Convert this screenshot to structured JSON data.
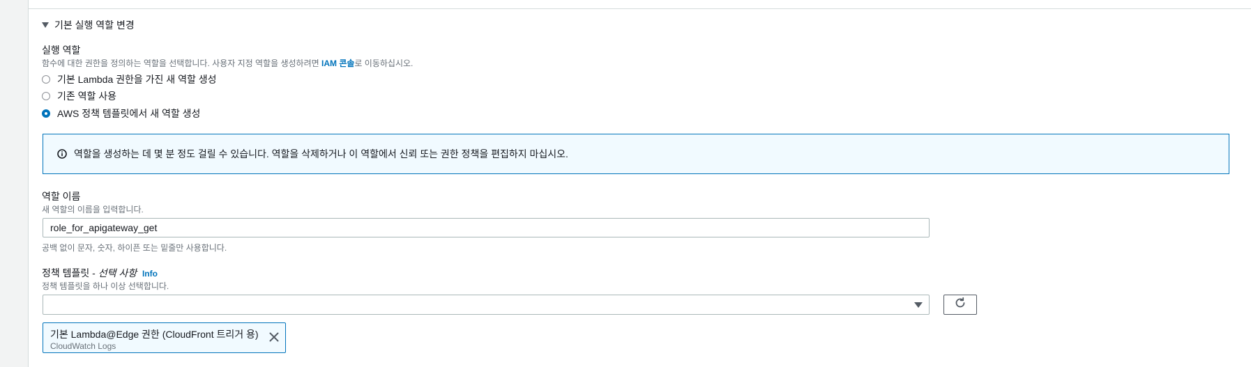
{
  "section": {
    "toggle_label": "기본 실행 역할 변경"
  },
  "execution_role": {
    "label": "실행 역할",
    "description_prefix": "함수에 대한 권한을 정의하는 역할을 선택합니다. 사용자 지정 역할을 생성하려면 ",
    "description_link": "IAM 콘솔",
    "description_suffix": "로 이동하십시오.",
    "options": [
      {
        "label": "기본 Lambda 권한을 가진 새 역할 생성",
        "checked": false
      },
      {
        "label": "기존 역할 사용",
        "checked": false
      },
      {
        "label": "AWS 정책 템플릿에서 새 역할 생성",
        "checked": true
      }
    ]
  },
  "info_alert": {
    "icon": "info-icon",
    "text": "역할을 생성하는 데 몇 분 정도 걸릴 수 있습니다. 역할을 삭제하거나 이 역할에서 신뢰 또는 권한 정책을 편집하지 마십시오."
  },
  "role_name": {
    "label": "역할 이름",
    "description": "새 역할의 이름을 입력합니다.",
    "value": "role_for_apigateway_get",
    "constraint": "공백 없이 문자, 숫자, 하이픈 또는 밑줄만 사용합니다."
  },
  "policy_templates": {
    "label": "정책 템플릿 - ",
    "optional": "선택 사항",
    "info_link": "Info",
    "description": "정책 템플릿을 하나 이상 선택합니다.",
    "select_value": "",
    "refresh_icon": "refresh-icon",
    "selected_tokens": [
      {
        "title": "기본 Lambda@Edge 권한 (CloudFront 트리거 용)",
        "subtitle": "CloudWatch Logs"
      }
    ]
  },
  "colors": {
    "link": "#0073bb",
    "info_bg": "#f1faff",
    "border": "#aab7b8"
  }
}
